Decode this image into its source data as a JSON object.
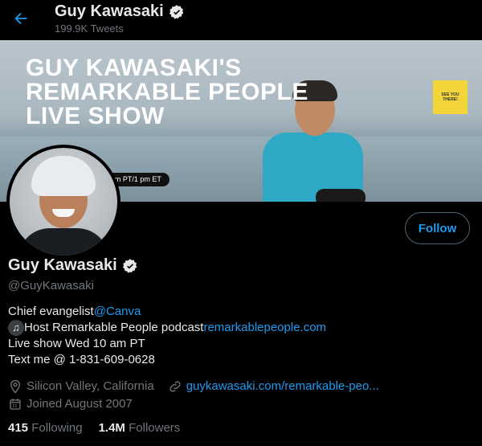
{
  "header": {
    "name": "Guy Kawasaki",
    "tweet_count": "199.9K Tweets",
    "back_icon": "arrow-left-icon"
  },
  "banner": {
    "line1": "GUY KAWASAKI'S",
    "line2": "REMARKABLE PEOPLE",
    "line3": "LIVE SHOW",
    "pill": "Every Wednesday at 10 am PT/1 pm ET",
    "badge": "SEE YOU THERE!"
  },
  "profile": {
    "name": "Guy Kawasaki",
    "handle": "@GuyKawasaki",
    "follow_label": "Follow",
    "verified_icon": "verified-badge-icon"
  },
  "bio": {
    "line1_text": "Chief evangelist ",
    "line1_link": "@Canva",
    "line2_text": " Host Remarkable People podcast ",
    "line2_link": "remarkablepeople.com",
    "line3": "Live show Wed 10 am PT",
    "line4": "Text me @ 1-831-609-0628"
  },
  "meta": {
    "location": "Silicon Valley, California",
    "website": "guykawasaki.com/remarkable-peo...",
    "joined": "Joined August 2007"
  },
  "stats": {
    "following_count": "415",
    "following_label": "Following",
    "followers_count": "1.4M",
    "followers_label": "Followers"
  },
  "colors": {
    "accent": "#1d9bf0",
    "secondary_text": "#71767b",
    "background": "#000000"
  }
}
